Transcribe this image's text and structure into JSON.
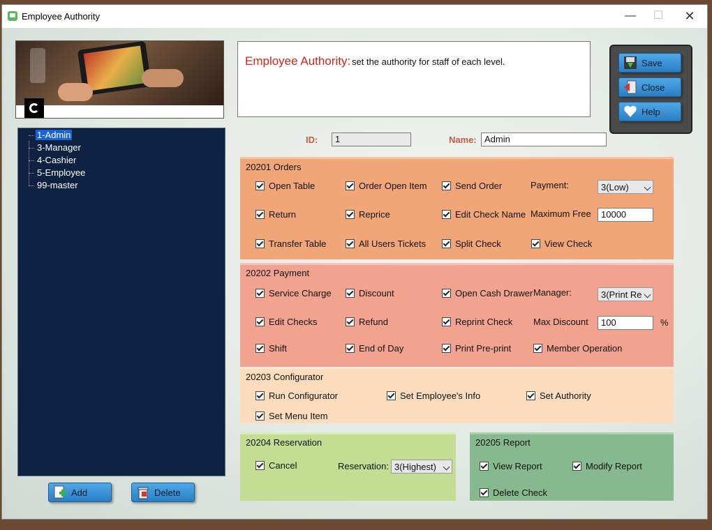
{
  "window": {
    "title": "Employee  Authority",
    "controls": {
      "minimize": "—",
      "maximize": "☐",
      "close": "✕"
    }
  },
  "employees": [
    "1-Admin",
    "3-Manager",
    "4-Cashier",
    "5-Employee",
    "99-master"
  ],
  "buttons": {
    "add": "Add",
    "delete": "Delete",
    "save": "Save",
    "close": "Close",
    "help": "Help"
  },
  "description": {
    "heading": "Employee Authority:",
    "text": "set the authority for staff of each level."
  },
  "form": {
    "id_label": "ID:",
    "id_value": "1",
    "name_label": "Name:",
    "name_value": "Admin"
  },
  "orders": {
    "title": "20201  Orders",
    "checks": [
      "Open Table",
      "Order Open Item",
      "Send Order",
      "Return",
      "Reprice",
      "Edit Check Name",
      "Transfer Table",
      "All Users Tickets",
      "Split Check",
      "View Check"
    ],
    "payment_label": "Payment:",
    "payment_value": "3(Low)",
    "max_free_label": "Maximum Free",
    "max_free_value": "10000"
  },
  "payment": {
    "title": "20202 Payment",
    "checks": [
      "Service Charge",
      "Discount",
      "Open Cash Drawer",
      "Edit Checks",
      "Refund",
      "Reprint Check",
      "Shift",
      "End of Day",
      "Print Pre-print",
      "Member Operation"
    ],
    "manager_label": "Manager:",
    "manager_value": "3(Print Re",
    "max_discount_label": "Max Discount",
    "max_discount_value": "100",
    "percent": "%"
  },
  "configurator": {
    "title": "20203 Configurator",
    "checks": [
      "Run Configurator",
      "Set Employee's Info",
      "Set Authority",
      "Set Menu Item"
    ]
  },
  "reservation": {
    "title": "20204 Reservation",
    "checks": [
      "Cancel"
    ],
    "reservation_label": "Reservation:",
    "reservation_value": "3(Highest)"
  },
  "report": {
    "title": "20205 Report",
    "checks": [
      "View Report",
      "Modify Report",
      "Delete Check"
    ]
  }
}
